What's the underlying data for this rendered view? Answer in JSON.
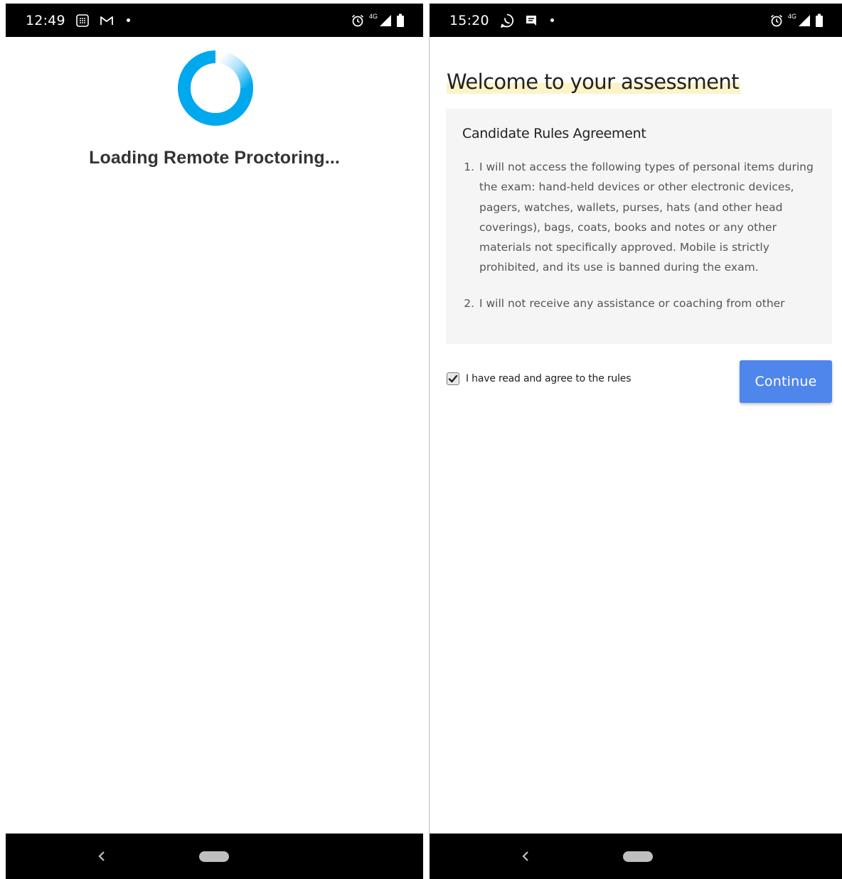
{
  "left_screen": {
    "status_bar": {
      "time": "12:49",
      "icons": [
        "calculator-icon",
        "gmail-icon",
        "notification-dot",
        "alarm-icon",
        "4g-icon",
        "signal-icon",
        "battery-icon"
      ],
      "network_label": "4G"
    },
    "loading_text": "Loading Remote Proctoring...",
    "spinner_color": "#00a8ee"
  },
  "right_screen": {
    "status_bar": {
      "time": "15:20",
      "icons": [
        "whatsapp-icon",
        "message-icon",
        "notification-dot",
        "alarm-icon",
        "4g-icon",
        "signal-icon",
        "battery-icon"
      ],
      "network_label": "4G"
    },
    "welcome_title": "Welcome to your assessment",
    "highlight_color": "#fdf3c8",
    "rules": {
      "title": "Candidate Rules Agreement",
      "items": [
        "I will not access the following types of personal items during the exam: hand-held devices or other electronic devices, pagers, watches, wallets, purses, hats (and other head coverings), bags, coats, books and notes or any other materials not specifically approved. Mobile is strictly prohibited, and its use is banned during the exam.",
        "I will not receive any assistance or coaching from other"
      ]
    },
    "agree_label": "I have read and agree to the rules",
    "agree_checked": true,
    "continue_label": "Continue",
    "accent_color": "#4f86ec"
  }
}
